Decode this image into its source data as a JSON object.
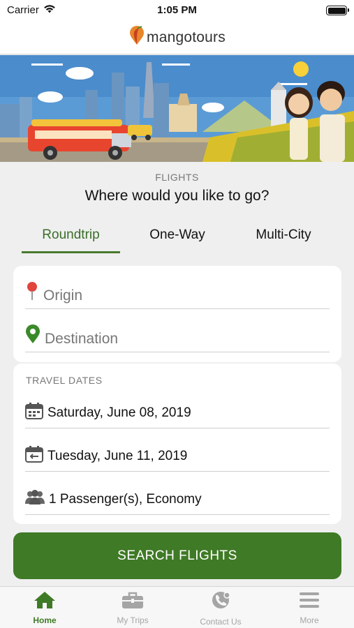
{
  "status_bar": {
    "carrier": "Carrier",
    "time": "1:05 PM"
  },
  "header": {
    "logo_text": "mangotours"
  },
  "page": {
    "section_label": "FLIGHTS",
    "title": "Where would you like to go?"
  },
  "trip_tabs": [
    {
      "label": "Roundtrip",
      "active": true
    },
    {
      "label": "One-Way",
      "active": false
    },
    {
      "label": "Multi-City",
      "active": false
    }
  ],
  "search_form": {
    "origin_placeholder": "Origin",
    "destination_placeholder": "Destination",
    "travel_dates_label": "TRAVEL DATES",
    "departure_date": "Saturday, June 08, 2019",
    "return_date": "Tuesday, June 11, 2019",
    "passengers": "1 Passenger(s), Economy"
  },
  "search_button_label": "SEARCH FLIGHTS",
  "bottom_nav": [
    {
      "label": "Home",
      "icon": "home-icon",
      "active": true
    },
    {
      "label": "My Trips",
      "icon": "briefcase-icon",
      "active": false
    },
    {
      "label": "Contact Us",
      "icon": "contact-icon",
      "active": false
    },
    {
      "label": "More",
      "icon": "menu-icon",
      "active": false
    }
  ],
  "colors": {
    "accent": "#3f7a26",
    "inactive_nav": "#a5a5a5",
    "origin_pin": "#e0443a",
    "destination_pin": "#3a8a2a"
  }
}
